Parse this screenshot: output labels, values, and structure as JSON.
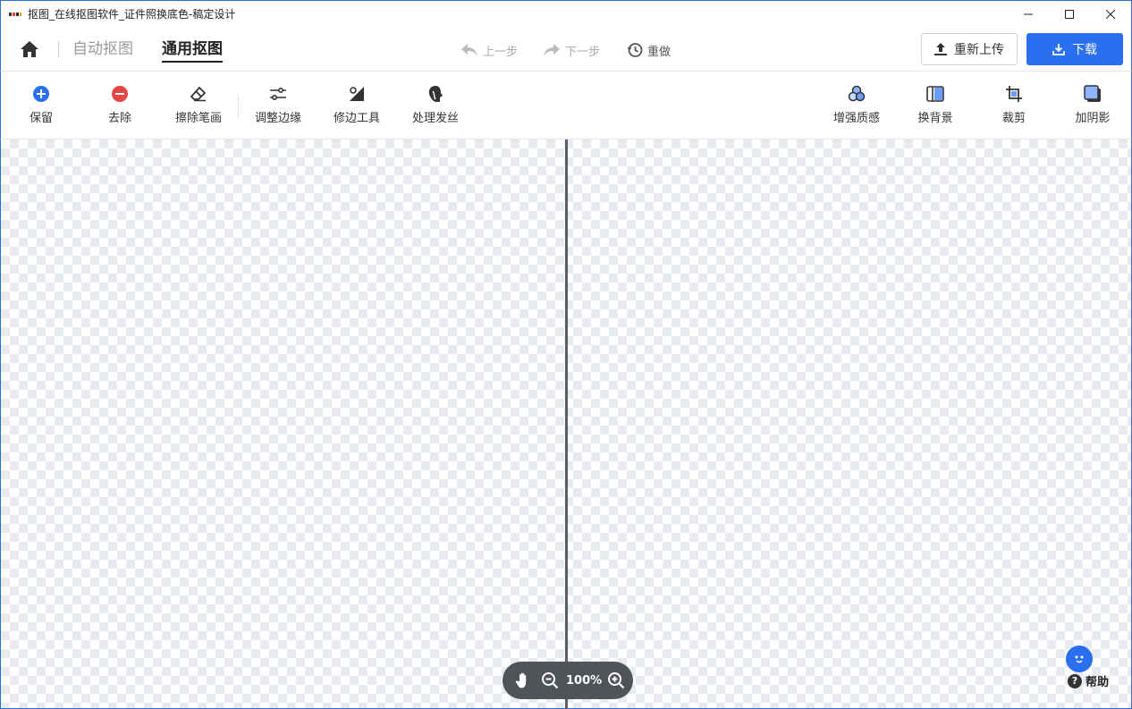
{
  "window": {
    "title": "抠图_在线抠图软件_证件照换底色-稿定设计"
  },
  "header": {
    "tabs": [
      {
        "label": "自动抠图",
        "active": false
      },
      {
        "label": "通用抠图",
        "active": true
      }
    ],
    "history": {
      "undo": "上一步",
      "redo": "下一步",
      "redo_all": "重做"
    },
    "reupload_label": "重新上传",
    "download_label": "下载"
  },
  "toolbar": {
    "left_tools": [
      {
        "label": "保留",
        "icon": "plus-circle-icon"
      },
      {
        "label": "去除",
        "icon": "minus-circle-icon"
      },
      {
        "label": "擦除笔画",
        "icon": "eraser-icon"
      },
      {
        "label": "调整边缘",
        "icon": "sliders-icon"
      },
      {
        "label": "修边工具",
        "icon": "edge-tool-icon"
      },
      {
        "label": "处理发丝",
        "icon": "hair-icon"
      }
    ],
    "right_tools": [
      {
        "label": "增强质感",
        "icon": "circles-icon"
      },
      {
        "label": "换背景",
        "icon": "background-icon"
      },
      {
        "label": "裁剪",
        "icon": "crop-icon"
      },
      {
        "label": "加阴影",
        "icon": "shadow-icon"
      }
    ]
  },
  "canvas": {
    "zoom": "100%"
  },
  "help": {
    "label": "帮助"
  },
  "colors": {
    "primary": "#2b6ff1",
    "keep": "#2b6ff1",
    "remove": "#e54545",
    "zoom_bar": "#505459"
  }
}
